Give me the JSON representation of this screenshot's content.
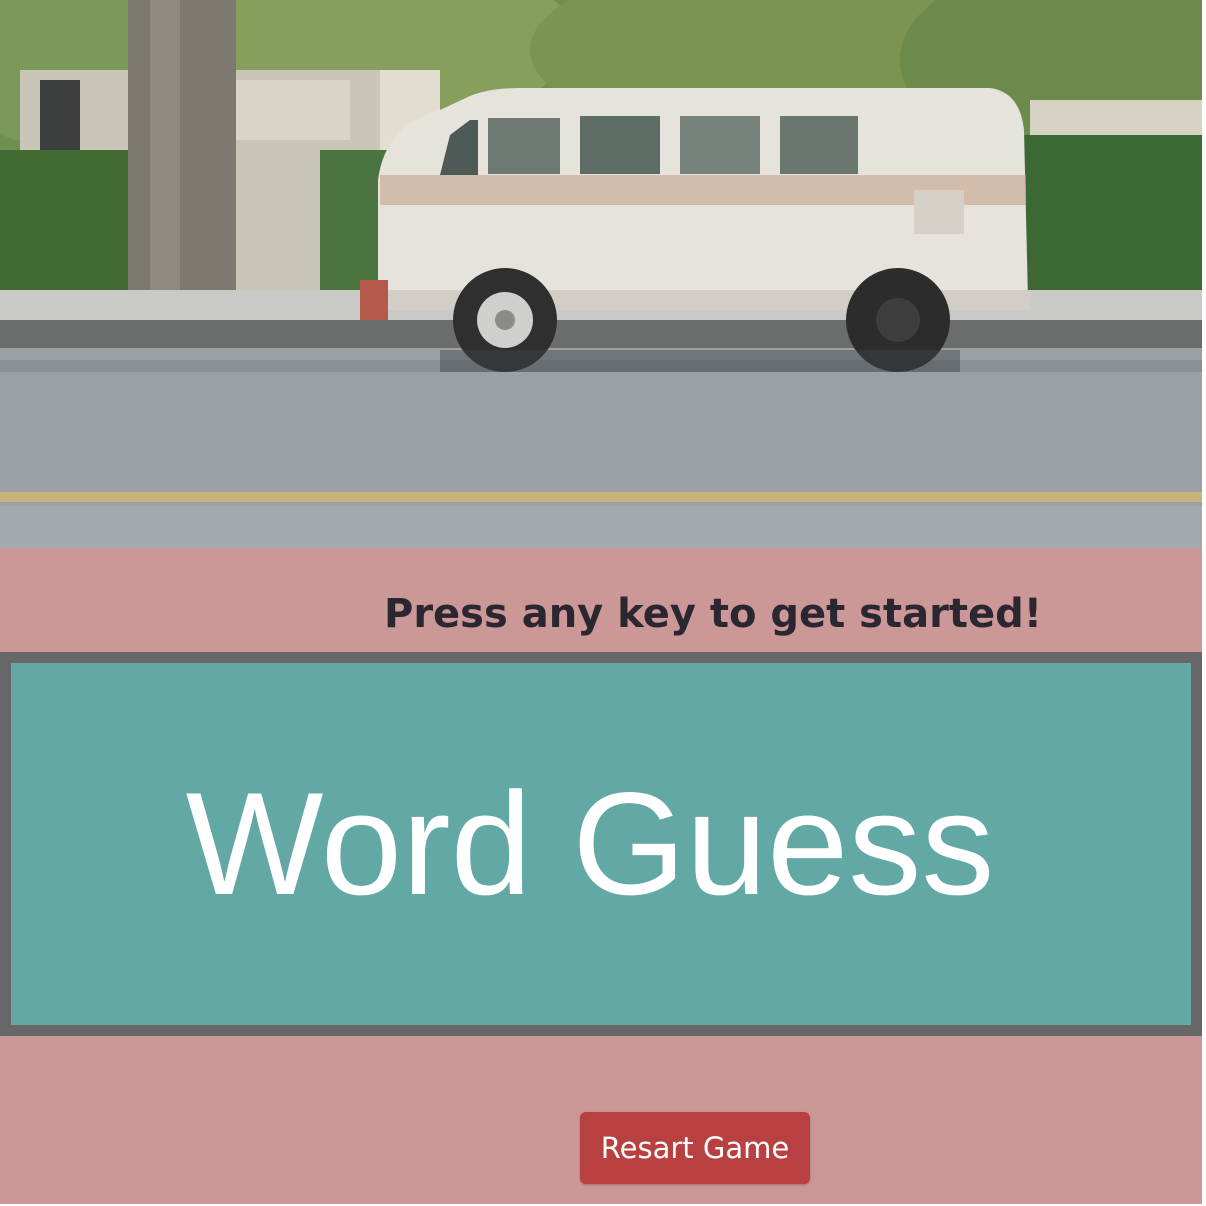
{
  "hero": {
    "image_icon": "vintage-van-photo"
  },
  "game": {
    "prompt": "Press any key to get started!",
    "title": "Word Guess",
    "restart_label": "Resart Game"
  },
  "colors": {
    "band": "#cc9797",
    "panel_border": "#676767",
    "panel_fill": "#62a8a5",
    "button": "#b84040"
  }
}
